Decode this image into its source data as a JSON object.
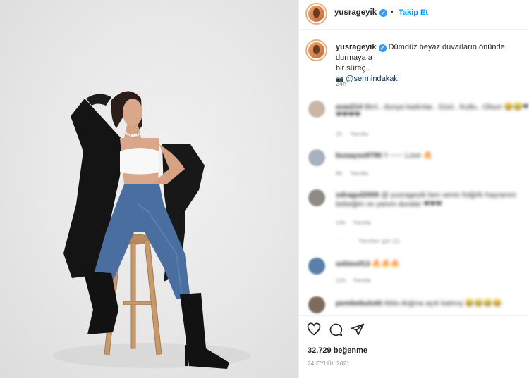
{
  "post": {
    "username": "yusrageyik",
    "follow_label": "Takip Et",
    "separator": "•"
  },
  "caption": {
    "username": "yusrageyik",
    "text": "Dümdüz beyaz duvarların önünde durmaya a",
    "text2": "bir süreç..",
    "camera_icon": "📷",
    "mention": "@sermindakak",
    "time": "24h"
  },
  "comments": [
    {
      "user": "avaı214",
      "text": "Birri.. dunya kadınlar.. Güzi.. Kutlu.. Olsun",
      "emoji": "😂😂❤",
      "line2": "❤❤❤❤",
      "time": "1h",
      "reply": "Yanıtla"
    },
    {
      "user": "busayss9790",
      "text": "!! ~~~ Love",
      "emoji": "🔥",
      "time": "6h",
      "reply": "Yanıtla"
    },
    {
      "user": "sdragul2009",
      "text": "@ yusrageyik ben senin fotğrfe hayranım",
      "line2": "bebeğim ve yanım duralar",
      "emoji": "❤❤❤",
      "time": "14h",
      "reply": "Yanıtla"
    },
    {
      "user": "selimof13",
      "text": "",
      "emoji": "🔥🔥🔥",
      "time": "12h",
      "reply": "Yanıtla"
    },
    {
      "user": "pembebulutti",
      "text": "Abla doğma açık katmış",
      "emoji": "😂😂😂😂",
      "time": "",
      "reply": ""
    }
  ],
  "view_replies": "Yanıtları gör (1)",
  "actions": {
    "like_icon": "heart-icon",
    "comment_icon": "comment-icon",
    "share_icon": "share-icon",
    "likes": "32.729 beğenme",
    "date": "24 EYLÜL 2021"
  },
  "colors": {
    "accent": "#0095f6",
    "verified": "#3897f0",
    "muted": "#8e8e8e",
    "border": "#efefef"
  }
}
